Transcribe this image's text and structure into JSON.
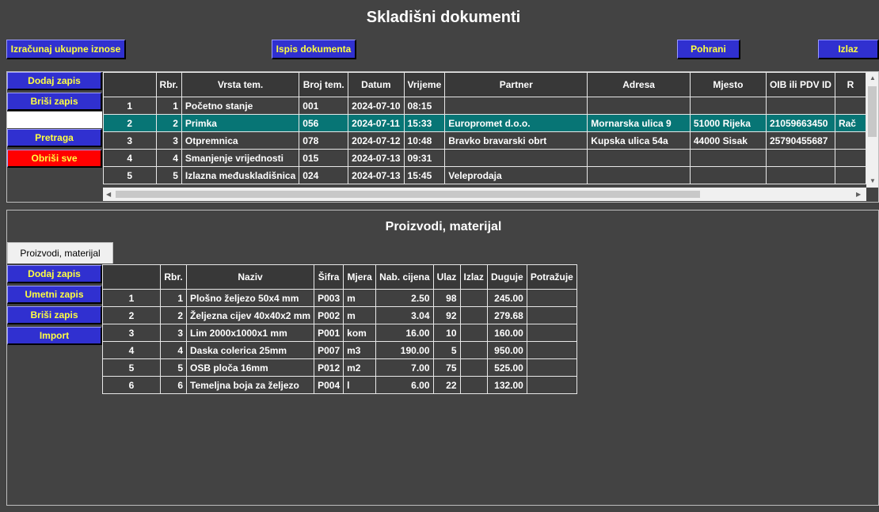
{
  "title": "Skladišni dokumenti",
  "toolbar": {
    "calc": "Izračunaj ukupne iznose",
    "print": "Ispis dokumenta",
    "save": "Pohrani",
    "exit": "Izlaz"
  },
  "docs": {
    "add": "Dodaj zapis",
    "delete": "Briši zapis",
    "search_value": "",
    "search": "Pretraga",
    "clear": "Obriši sve",
    "columns": [
      "",
      "Rbr.",
      "Vrsta tem.",
      "Broj tem.",
      "Datum",
      "Vrijeme",
      "Partner",
      "Adresa",
      "Mjesto",
      "OIB ili PDV ID",
      "R"
    ],
    "rows": [
      [
        "1",
        "1",
        "Početno stanje",
        "001",
        "2024-07-10",
        "08:15",
        "",
        "",
        "",
        "",
        ""
      ],
      [
        "2",
        "2",
        "Primka",
        "056",
        "2024-07-11",
        "15:33",
        "Europromet d.o.o.",
        "Mornarska ulica 9",
        "51000 Rijeka",
        "21059663450",
        "Rač"
      ],
      [
        "3",
        "3",
        "Otpremnica",
        "078",
        "2024-07-12",
        "10:48",
        "Bravko bravarski obrt",
        "Kupska ulica 54a",
        "44000 Sisak",
        "25790455687",
        ""
      ],
      [
        "4",
        "4",
        "Smanjenje vrijednosti",
        "015",
        "2024-07-13",
        "09:31",
        "",
        "",
        "",
        "",
        ""
      ],
      [
        "5",
        "5",
        "Izlazna međuskladišnica",
        "024",
        "2024-07-13",
        "15:45",
        "Veleprodaja",
        "",
        "",
        "",
        ""
      ]
    ]
  },
  "products": {
    "section_title": "Proizvodi, materijal",
    "tab": "Proizvodi, materijal",
    "add": "Dodaj zapis",
    "insert": "Umetni zapis",
    "delete": "Briši zapis",
    "import": "Import",
    "columns": [
      "",
      "Rbr.",
      "Naziv",
      "Šifra",
      "Mjera",
      "Nab. cijena",
      "Ulaz",
      "Izlaz",
      "Duguje",
      "Potražuje"
    ],
    "rows": [
      [
        "1",
        "1",
        "Plošno željezo 50x4 mm",
        "P003",
        "m",
        "2.50",
        "98",
        "",
        "245.00",
        ""
      ],
      [
        "2",
        "2",
        "Željezna cijev 40x40x2 mm",
        "P002",
        "m",
        "3.04",
        "92",
        "",
        "279.68",
        ""
      ],
      [
        "3",
        "3",
        "Lim 2000x1000x1 mm",
        "P001",
        "kom",
        "16.00",
        "10",
        "",
        "160.00",
        ""
      ],
      [
        "4",
        "4",
        "Daska colerica 25mm",
        "P007",
        "m3",
        "190.00",
        "5",
        "",
        "950.00",
        ""
      ],
      [
        "5",
        "5",
        "OSB ploča 16mm",
        "P012",
        "m2",
        "7.00",
        "75",
        "",
        "525.00",
        ""
      ],
      [
        "6",
        "6",
        "Temeljna boja za željezo",
        "P004",
        "l",
        "6.00",
        "22",
        "",
        "132.00",
        ""
      ]
    ]
  },
  "colors": {
    "background": "#434343",
    "button": "#3030d0",
    "button_text": "#ffff40",
    "danger": "#ff0000",
    "selected_row": "#077575"
  }
}
